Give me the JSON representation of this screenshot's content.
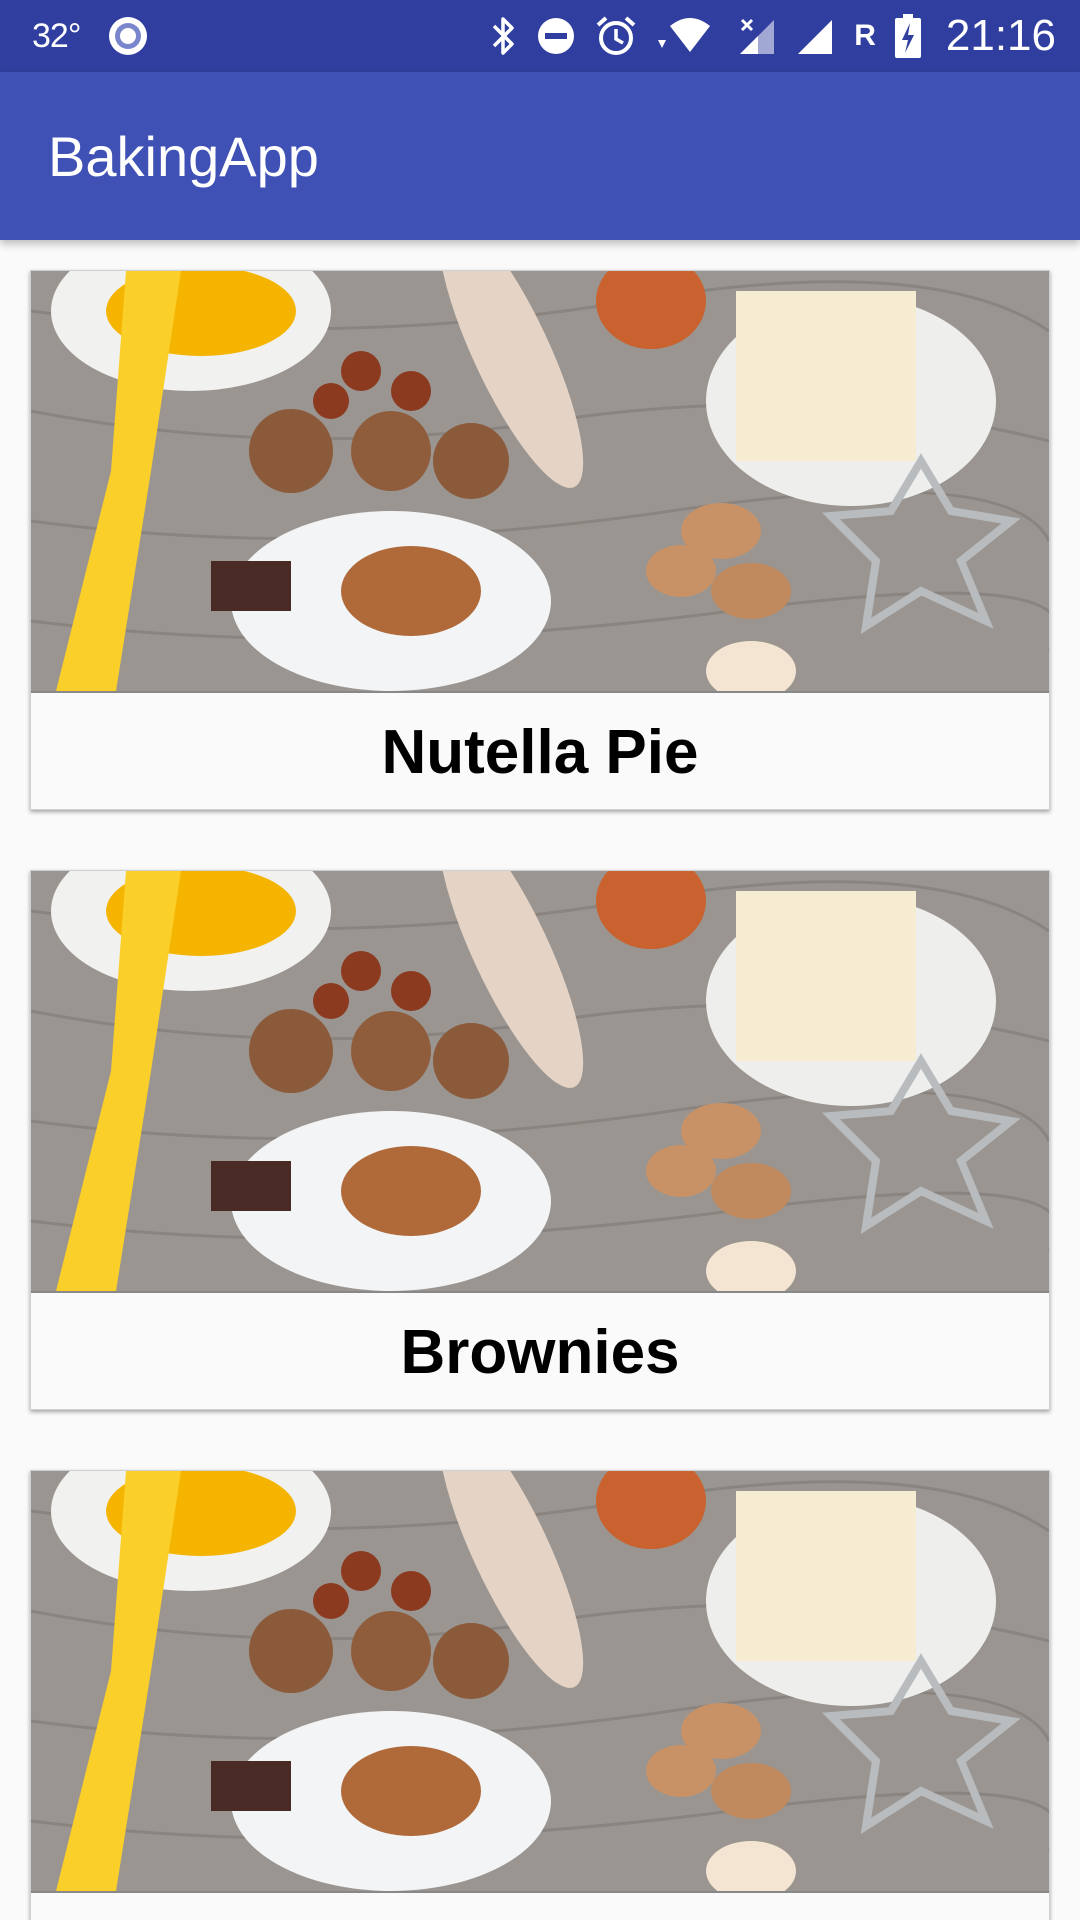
{
  "status_bar": {
    "temperature": "32°",
    "network_type": "R",
    "time": "21:16",
    "icons": [
      "location-icon",
      "bluetooth-icon",
      "do-not-disturb-icon",
      "alarm-icon",
      "wifi-icon",
      "signal-icon",
      "battery-charging-icon"
    ]
  },
  "app_bar": {
    "title": "BakingApp"
  },
  "recipes": [
    {
      "name": "Nutella Pie"
    },
    {
      "name": "Brownies"
    },
    {
      "name": ""
    }
  ],
  "colors": {
    "status_bar": "#303F9F",
    "app_bar": "#3F51B5",
    "background": "#FAFAFA"
  }
}
